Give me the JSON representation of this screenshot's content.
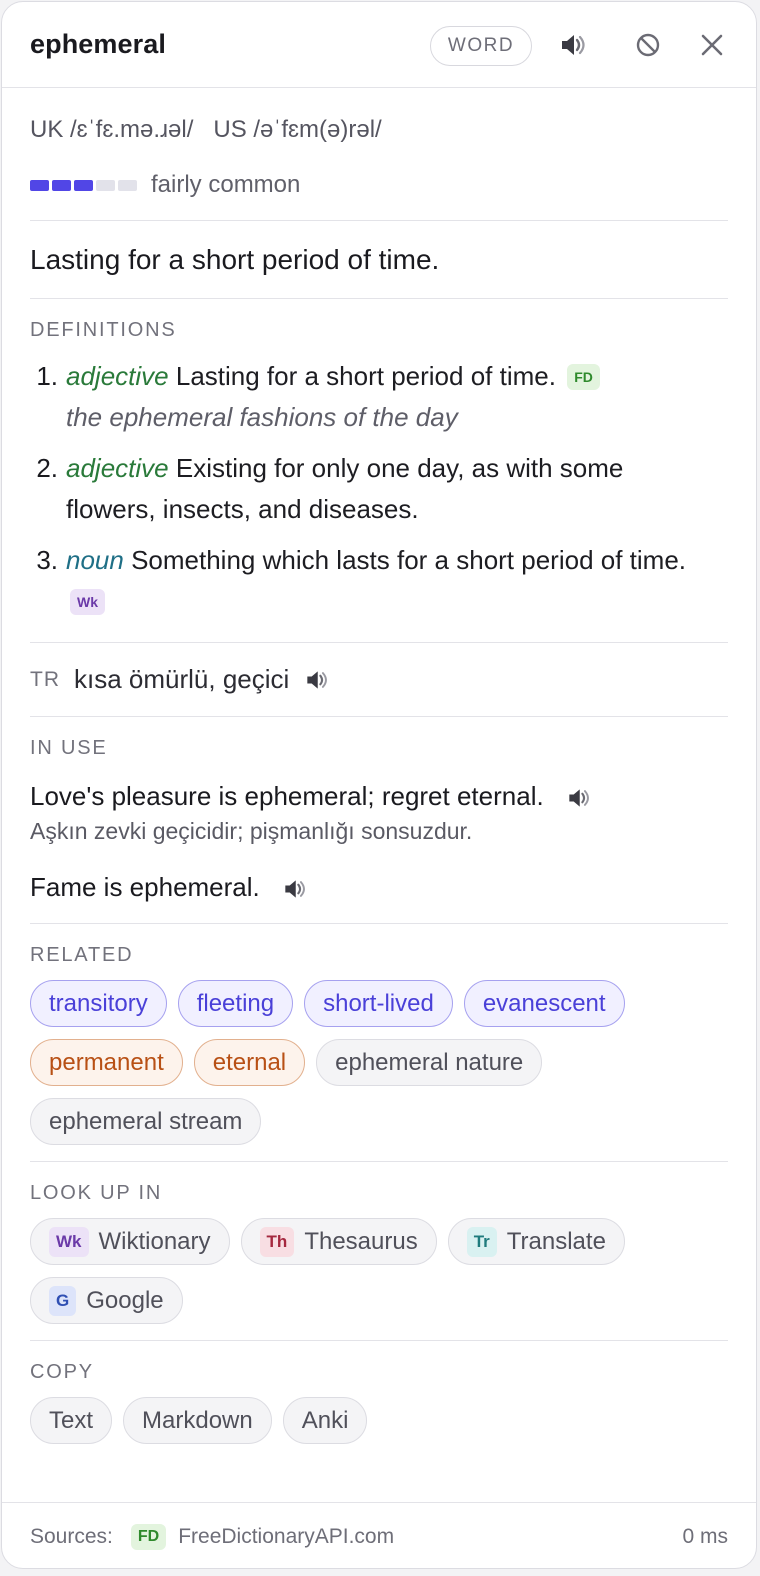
{
  "header": {
    "title": "ephemeral",
    "badge": "WORD"
  },
  "pronunciation": {
    "uk": "UK /ɛˈfɛ.mə.ɹəl/",
    "us": "US /əˈfɛm(ə)rəl/"
  },
  "frequency": {
    "level": 3,
    "max": 5,
    "label": "fairly common"
  },
  "summary": "Lasting for a short period of time.",
  "definitions": {
    "label": "DEFINITIONS",
    "items": [
      {
        "num": "1.",
        "pos": "adjective",
        "text": "Lasting for a short period of time.",
        "source": "FD",
        "example": "the ephemeral fashions of the day"
      },
      {
        "num": "2.",
        "pos": "adjective",
        "text": "Existing for only one day, as with some flowers, insects, and diseases."
      },
      {
        "num": "3.",
        "pos": "noun",
        "text": "Something which lasts for a short period of time.",
        "source": "Wk"
      }
    ]
  },
  "translation": {
    "lang": "TR",
    "text": "kısa ömürlü, geçici"
  },
  "in_use": {
    "label": "IN USE",
    "examples": [
      {
        "text": "Love's pleasure is ephemeral; regret eternal.",
        "translation": "Aşkın zevki geçicidir; pişmanlığı sonsuzdur."
      },
      {
        "text": "Fame is ephemeral."
      }
    ]
  },
  "related": {
    "label": "RELATED",
    "synonyms": [
      "transitory",
      "fleeting",
      "short-lived",
      "evanescent"
    ],
    "antonyms": [
      "permanent",
      "eternal"
    ],
    "phrases": [
      "ephemeral nature",
      "ephemeral stream"
    ]
  },
  "lookup": {
    "label": "LOOK UP IN",
    "items": [
      {
        "badge": "Wk",
        "label": "Wiktionary"
      },
      {
        "badge": "Th",
        "label": "Thesaurus"
      },
      {
        "badge": "Tr",
        "label": "Translate"
      },
      {
        "badge": "G",
        "label": "Google"
      }
    ]
  },
  "copy": {
    "label": "COPY",
    "items": [
      "Text",
      "Markdown",
      "Anki"
    ]
  },
  "footer": {
    "sources_label": "Sources:",
    "source_badge": "FD",
    "source_name": "FreeDictionaryAPI.com",
    "timing": "0 ms"
  },
  "colors": {
    "accent": "#5146e6",
    "adjective": "#2a7a3a",
    "noun": "#1f6f86",
    "antonym": "#b85015"
  },
  "icons": [
    "speaker-icon",
    "block-icon",
    "close-icon"
  ]
}
